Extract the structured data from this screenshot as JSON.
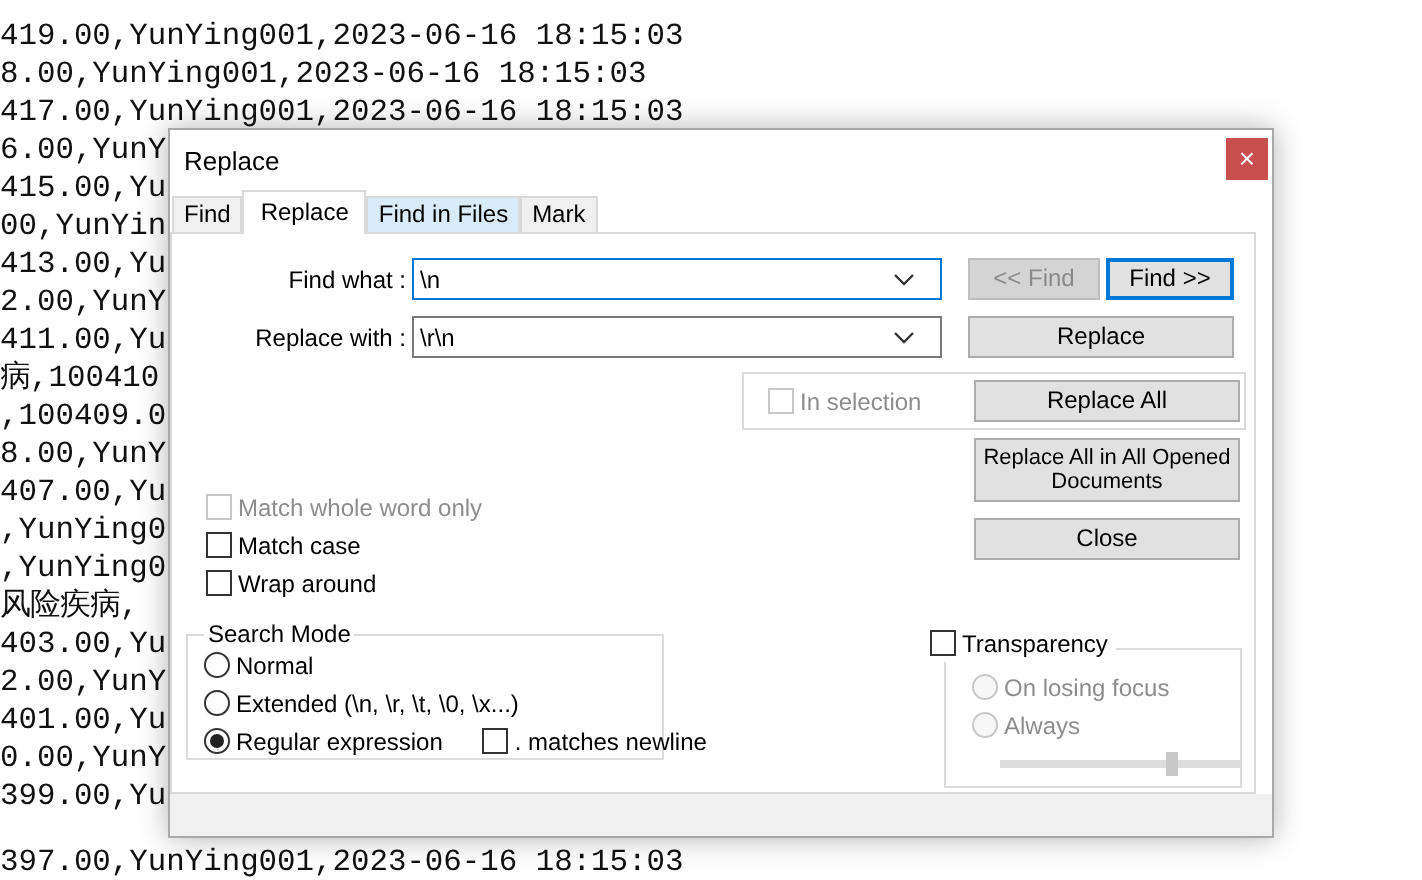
{
  "editor_lines": [
    "419.00,YunYing001,2023-06-16 18:15:03",
    "8.00,YunYing001,2023-06-16 18:15:03",
    "417.00,YunYing001,2023-06-16 18:15:03",
    "6.00,YunY",
    "415.00,Yu",
    "00,YunYin",
    "413.00,Yu",
    "2.00,YunY",
    "411.00,Yu",
    "病,100410",
    ",100409.0",
    "8.00,YunY",
    "407.00,Yu",
    ",YunYing0",
    ",YunYing0",
    "风险疾病,",
    "403.00,Yu",
    "2.00,YunY",
    "401.00,Yu",
    "0.00,YunY",
    "399.00,Yu"
  ],
  "lines_below_dialog": [
    "397.00,YunYing001,2023-06-16 18:15:03"
  ],
  "dialog": {
    "title": "Replace",
    "close": "×",
    "tabs": [
      {
        "label": "Find",
        "selected": false,
        "hovered": false
      },
      {
        "label": "Replace",
        "selected": true,
        "hovered": false
      },
      {
        "label": "Find in Files",
        "selected": false,
        "hovered": true
      },
      {
        "label": "Mark",
        "selected": false,
        "hovered": false
      }
    ],
    "find_what": {
      "label": "Find what :",
      "value": "\\n",
      "focused": true
    },
    "replace_with": {
      "label": "Replace with :",
      "value": "\\r\\n",
      "focused": false
    },
    "find_previous": {
      "label": "<< Find",
      "disabled": true
    },
    "find_next": {
      "label": "Find >>",
      "disabled": false,
      "default": true
    },
    "replace": {
      "label": "Replace",
      "disabled": false
    },
    "in_selection": {
      "label": "In selection",
      "checked": false,
      "disabled": true
    },
    "replace_all": {
      "label": "Replace All",
      "disabled": false
    },
    "replace_all_opened": {
      "label": "Replace All in All Opened Documents",
      "disabled": false
    },
    "close_button": {
      "label": "Close",
      "disabled": false
    },
    "options": [
      {
        "label": "Match whole word only",
        "checked": false,
        "disabled": true
      },
      {
        "label": "Match case",
        "checked": false,
        "disabled": false
      },
      {
        "label": "Wrap around",
        "checked": false,
        "disabled": false
      }
    ],
    "search_mode": {
      "title": "Search Mode",
      "modes": [
        {
          "label": "Normal",
          "selected": false
        },
        {
          "label": "Extended (\\n, \\r, \\t, \\0, \\x...)",
          "selected": false
        },
        {
          "label": "Regular expression",
          "selected": true
        }
      ],
      "dot_matches_newline": {
        "label": ". matches newline",
        "checked": false,
        "disabled": false
      }
    },
    "transparency": {
      "label": "Transparency",
      "checked": false,
      "disabled": false,
      "modes": [
        {
          "label": "On losing focus",
          "selected": false,
          "disabled": true
        },
        {
          "label": "Always",
          "selected": false,
          "disabled": true
        }
      ],
      "level": 0.72
    }
  }
}
